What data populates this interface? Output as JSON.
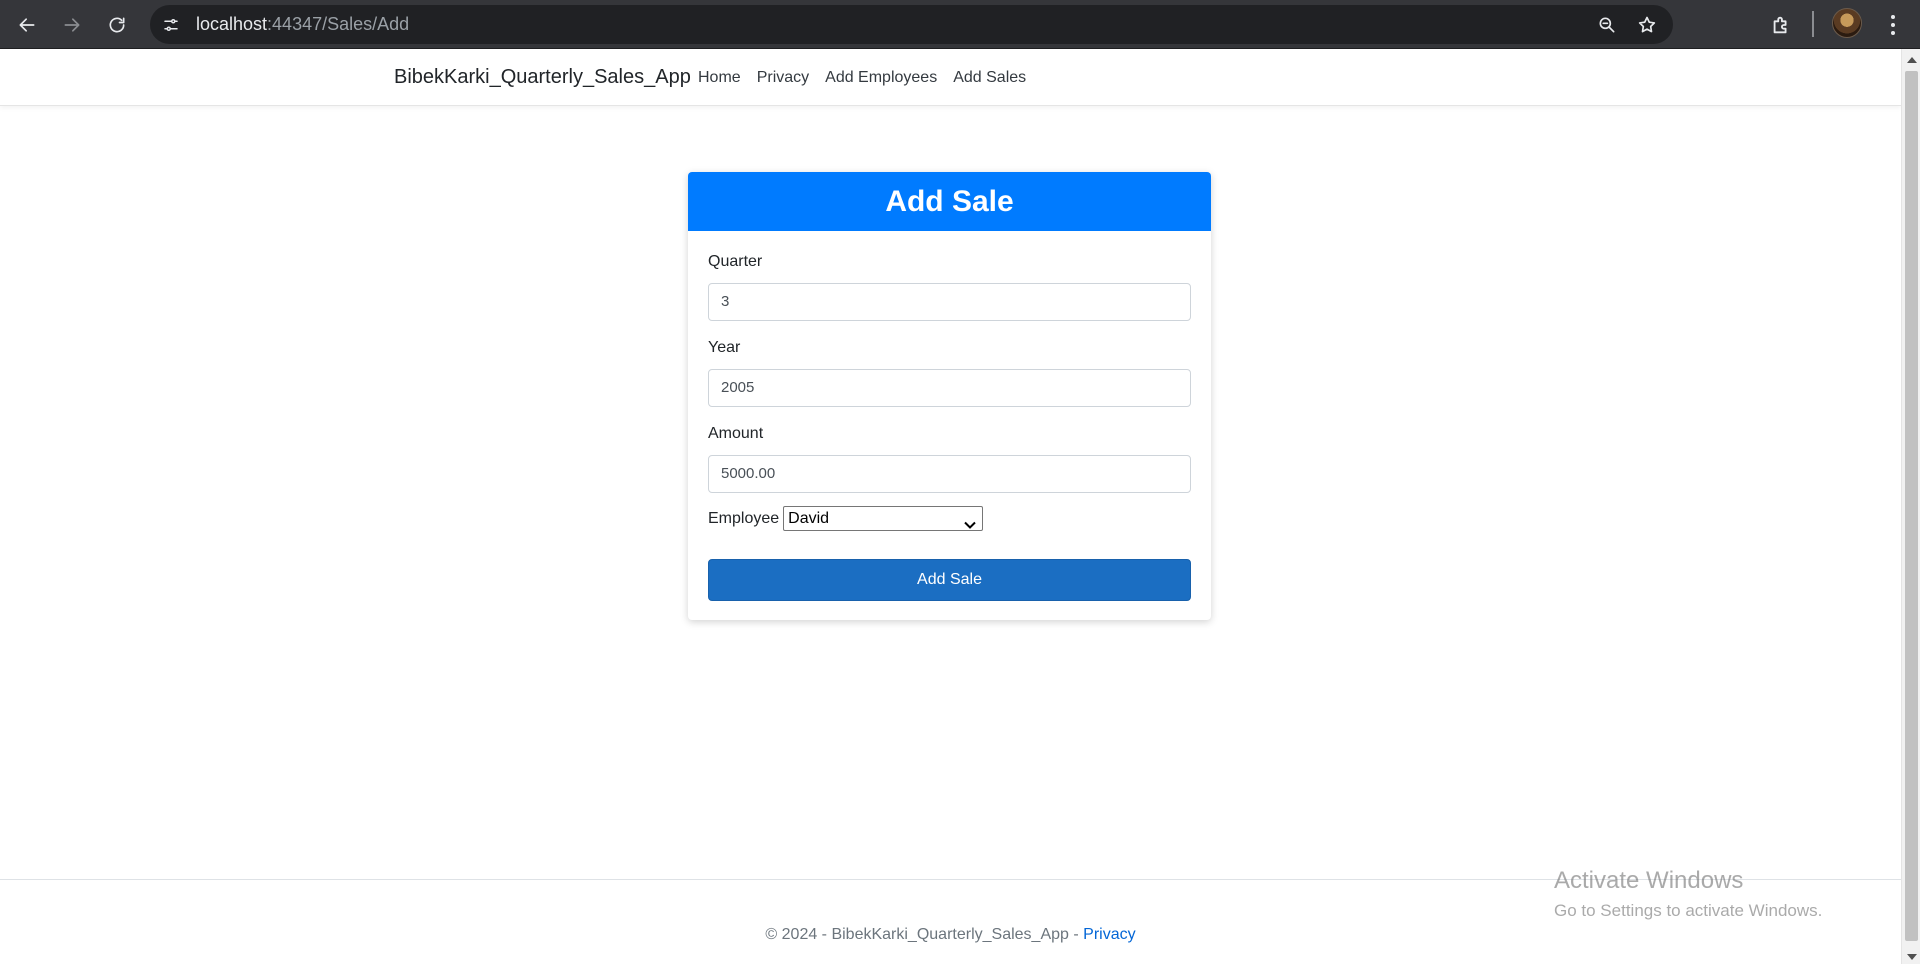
{
  "browser": {
    "url_host": "localhost",
    "url_rest": ":44347/Sales/Add"
  },
  "navbar": {
    "brand": "BibekKarki_Quarterly_Sales_App",
    "links": [
      "Home",
      "Privacy",
      "Add Employees",
      "Add Sales"
    ]
  },
  "form": {
    "title": "Add Sale",
    "quarter_label": "Quarter",
    "quarter_value": "3",
    "year_label": "Year",
    "year_value": "2005",
    "amount_label": "Amount",
    "amount_value": "5000.00",
    "employee_label": "Employee",
    "employee_value": "David",
    "submit_label": "Add Sale"
  },
  "footer": {
    "text": "© 2024 - BibekKarki_Quarterly_Sales_App - ",
    "privacy_link": "Privacy"
  },
  "watermark": {
    "line1": "Activate Windows",
    "line2": "Go to Settings to activate Windows."
  },
  "colors": {
    "header_blue": "#007bff",
    "button_blue": "#1b6ec2",
    "link_blue": "#0366d6"
  }
}
